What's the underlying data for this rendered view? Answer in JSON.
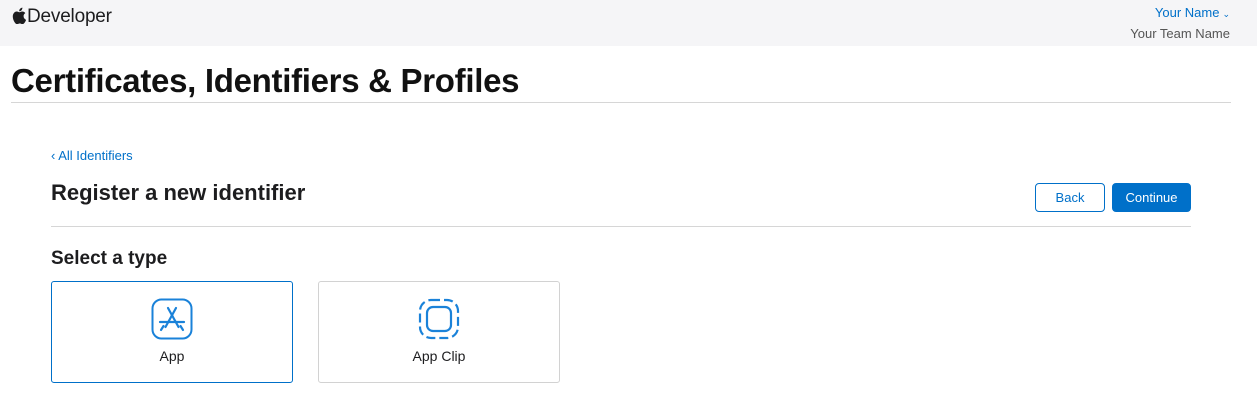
{
  "header": {
    "brand": "Developer",
    "user_name": "Your Name",
    "team_name": "Your Team Name"
  },
  "page": {
    "title": "Certificates, Identifiers & Profiles",
    "back_link": "All Identifiers",
    "section_title": "Register a new identifier",
    "back_button": "Back",
    "continue_button": "Continue",
    "select_type_heading": "Select a type"
  },
  "types": [
    {
      "label": "App",
      "icon": "app-store-icon",
      "selected": true
    },
    {
      "label": "App Clip",
      "icon": "app-clip-icon",
      "selected": false
    }
  ],
  "colors": {
    "accent": "#0070c9",
    "topbar_bg": "#f5f5f7",
    "rule": "#d6d6d6"
  }
}
